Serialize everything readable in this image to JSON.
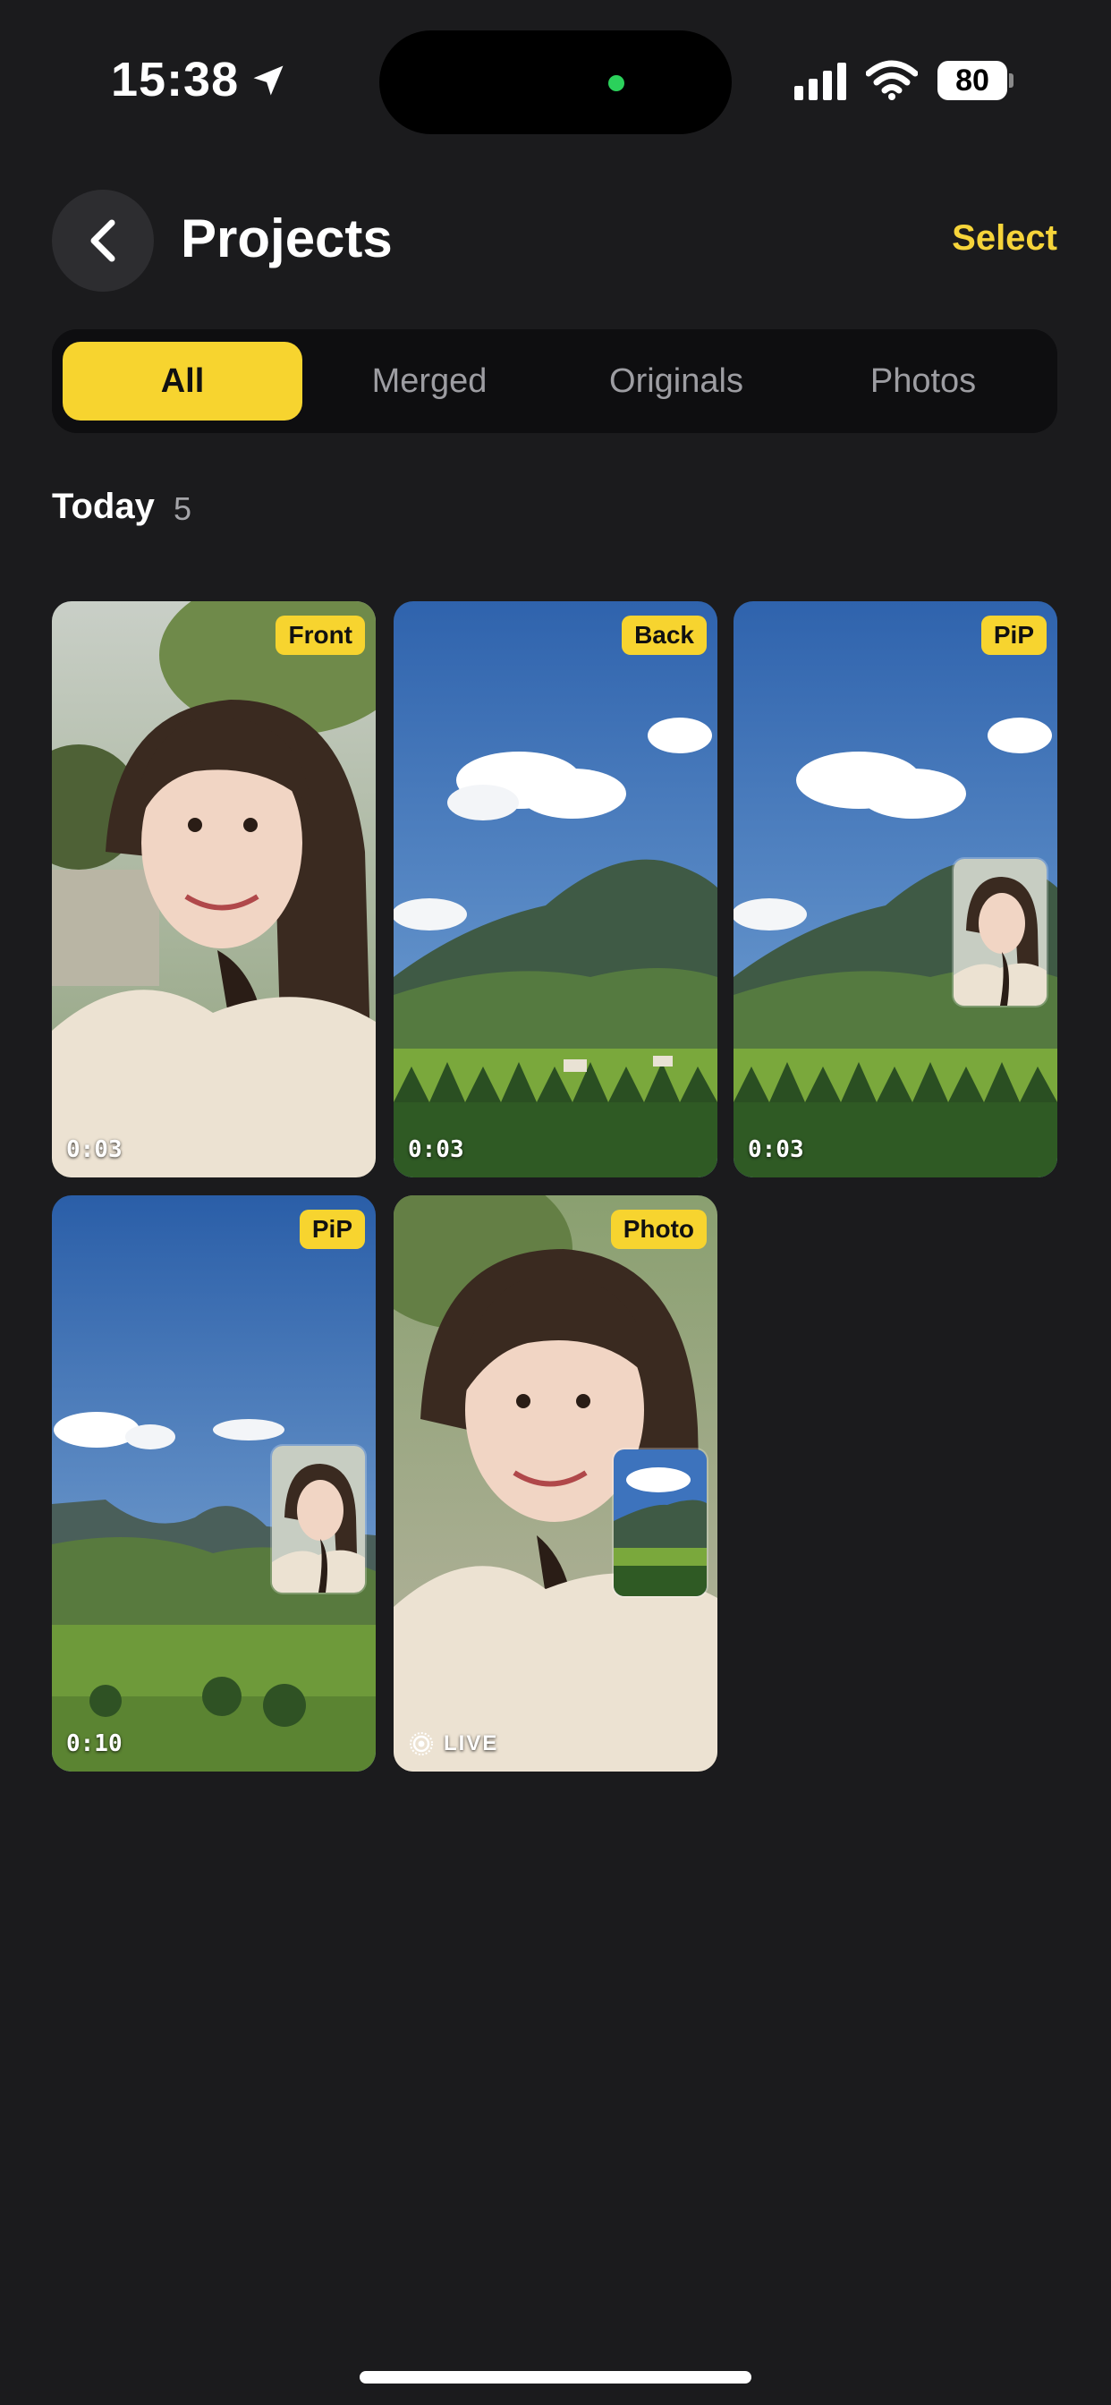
{
  "status_bar": {
    "time": "15:38",
    "battery": "80"
  },
  "header": {
    "title": "Projects",
    "select_label": "Select"
  },
  "filters": {
    "tabs": [
      "All",
      "Merged",
      "Originals",
      "Photos"
    ],
    "selected": "All"
  },
  "section": {
    "title": "Today",
    "count": "5"
  },
  "items": [
    {
      "badge": "Front",
      "duration": "0:03",
      "content": "selfie"
    },
    {
      "badge": "Back",
      "duration": "0:03",
      "content": "landscape"
    },
    {
      "badge": "PiP",
      "duration": "0:03",
      "content": "landscape-with-selfie-inset"
    },
    {
      "badge": "PiP",
      "duration": "0:10",
      "content": "landscape-with-selfie-inset"
    },
    {
      "badge": "Photo",
      "live_label": "LIVE",
      "content": "selfie-with-landscape-inset"
    }
  ],
  "colors": {
    "accent": "#f7d42f",
    "background": "#1b1b1d"
  },
  "icons": [
    "location-arrow-icon",
    "signal-icon",
    "wifi-icon",
    "battery-icon",
    "back-chevron-icon",
    "live-photo-icon"
  ]
}
